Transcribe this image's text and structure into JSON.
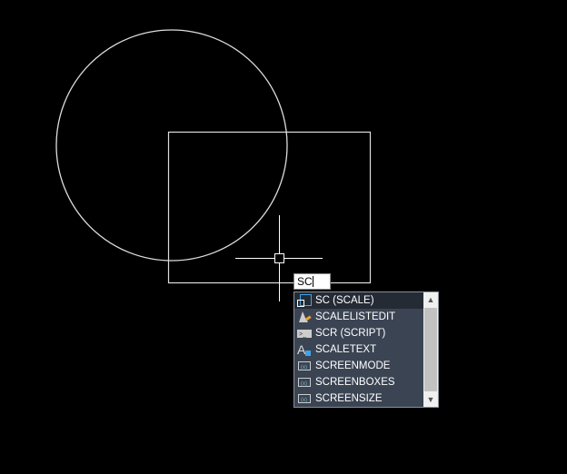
{
  "command_input": {
    "value": "SC"
  },
  "autocomplete": {
    "items": [
      {
        "label": "SC (SCALE)",
        "icon": "scale-icon",
        "selected": true
      },
      {
        "label": "SCALELISTEDIT",
        "icon": "scale-list-edit-icon"
      },
      {
        "label": "SCR (SCRIPT)",
        "icon": "script-icon"
      },
      {
        "label": "SCALETEXT",
        "icon": "scaletext-icon"
      },
      {
        "label": "SCREENMODE",
        "icon": "system-variable-icon"
      },
      {
        "label": "SCREENBOXES",
        "icon": "system-variable-icon"
      },
      {
        "label": "SCREENSIZE",
        "icon": "system-variable-icon"
      }
    ]
  },
  "colors": {
    "background": "#000000",
    "geometry": "#ffffff",
    "list_bg": "#3b4453",
    "selected_bg": "#252b35",
    "accent": "#3fa3e8"
  }
}
